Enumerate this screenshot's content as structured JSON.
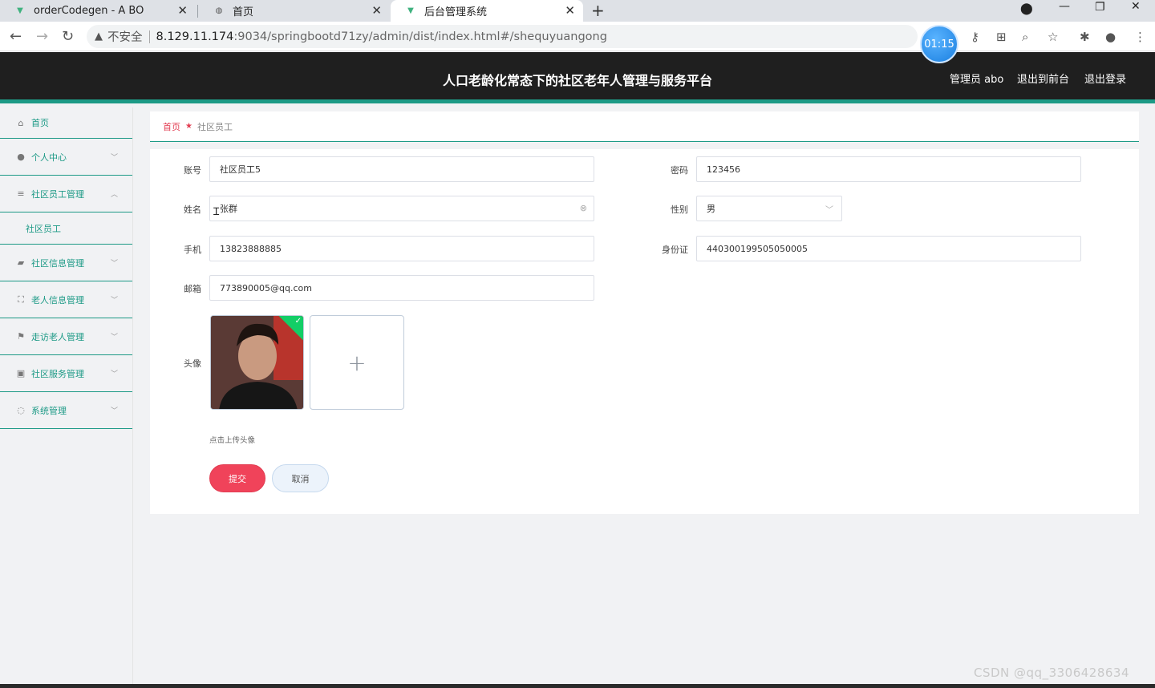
{
  "browser": {
    "tabs": [
      {
        "label": "orderCodegen - A BO",
        "favicon": "vue-icon"
      },
      {
        "label": "首页",
        "favicon": "globe-icon"
      },
      {
        "label": "后台管理系统",
        "favicon": "vue-icon"
      }
    ],
    "address": {
      "security": "不安全",
      "host": "8.129.11.174",
      "path": ":9034/springbootd71zy/admin/dist/index.html#/shequyuangong"
    },
    "timer": "01:15"
  },
  "header": {
    "title": "人口老龄化常态下的社区老年人管理与服务平台",
    "user": "管理员 abo",
    "to_front": "退出到前台",
    "logout": "退出登录"
  },
  "sidebar": {
    "items": [
      {
        "label": "首页",
        "icon": "home-icon"
      },
      {
        "label": "个人中心",
        "icon": "user-icon"
      },
      {
        "label": "社区员工管理",
        "icon": "list-icon"
      },
      {
        "label": "社区员工",
        "sub": true
      },
      {
        "label": "社区信息管理",
        "icon": "briefcase-icon"
      },
      {
        "label": "老人信息管理",
        "icon": "frame-icon"
      },
      {
        "label": "走访老人管理",
        "icon": "flag-icon"
      },
      {
        "label": "社区服务管理",
        "icon": "building-icon"
      },
      {
        "label": "系统管理",
        "icon": "mic-icon"
      }
    ]
  },
  "breadcrumb": {
    "home": "首页",
    "current": "社区员工"
  },
  "form": {
    "account_label": "账号",
    "account_value": "社区员工5",
    "password_label": "密码",
    "password_value": "123456",
    "name_label": "姓名",
    "name_value": "张群",
    "gender_label": "性别",
    "gender_value": "男",
    "phone_label": "手机",
    "phone_value": "13823888885",
    "idcard_label": "身份证",
    "idcard_value": "440300199505050005",
    "email_label": "邮箱",
    "email_value": "773890005@qq.com",
    "avatar_label": "头像",
    "upload_tip": "点击上传头像",
    "submit": "提交",
    "cancel": "取消"
  },
  "watermark": "CSDN @qq_3306428634"
}
